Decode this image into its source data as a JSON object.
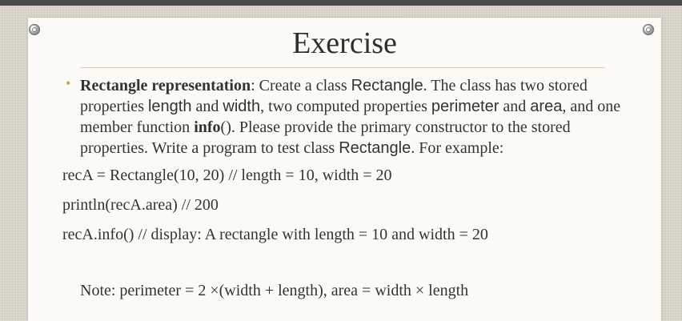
{
  "slide": {
    "title": "Exercise",
    "bullet": {
      "lead_bold": "Rectangle representation",
      "t1": ": Create a class ",
      "class_name": "Rectangle",
      "t2": ". The class has two stored properties ",
      "prop_length": "length",
      "t3": " and ",
      "prop_width": "width",
      "t4": ", two computed properties ",
      "prop_perimeter": "perimeter",
      "t5": " and ",
      "prop_area": "area",
      "t6": ", and one member function ",
      "func_bold": "info",
      "t7": "(). Please provide the primary constructor to the stored properties. Write a program to test class ",
      "class_name2": "Rectangle",
      "t8": ". For example:"
    },
    "code": {
      "line1": "recA = Rectangle(10, 20)   // length = 10, width = 20",
      "line2": "println(recA.area)  // 200",
      "line3": "recA.info()  // display: A rectangle with length = 10 and width = 20"
    },
    "note": "Note: perimeter =  2 ×(width + length), area = width × length"
  }
}
